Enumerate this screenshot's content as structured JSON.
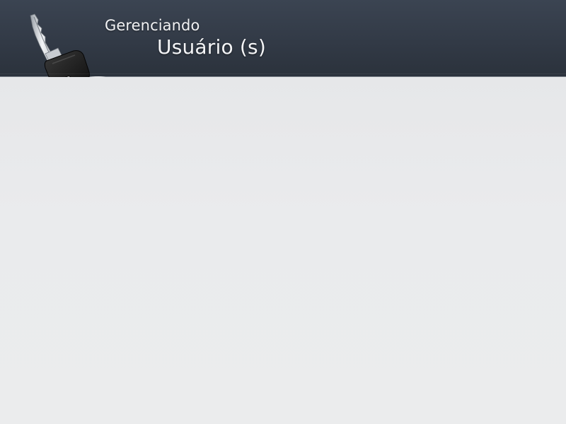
{
  "header": {
    "title_line1": "Gerenciando",
    "title_line2": "Usuário (s)",
    "icon": "key-icon"
  },
  "colors": {
    "header_bg": "#343c48",
    "content_bg": "#e9eaeb",
    "title_text": "#f2f3f5"
  }
}
